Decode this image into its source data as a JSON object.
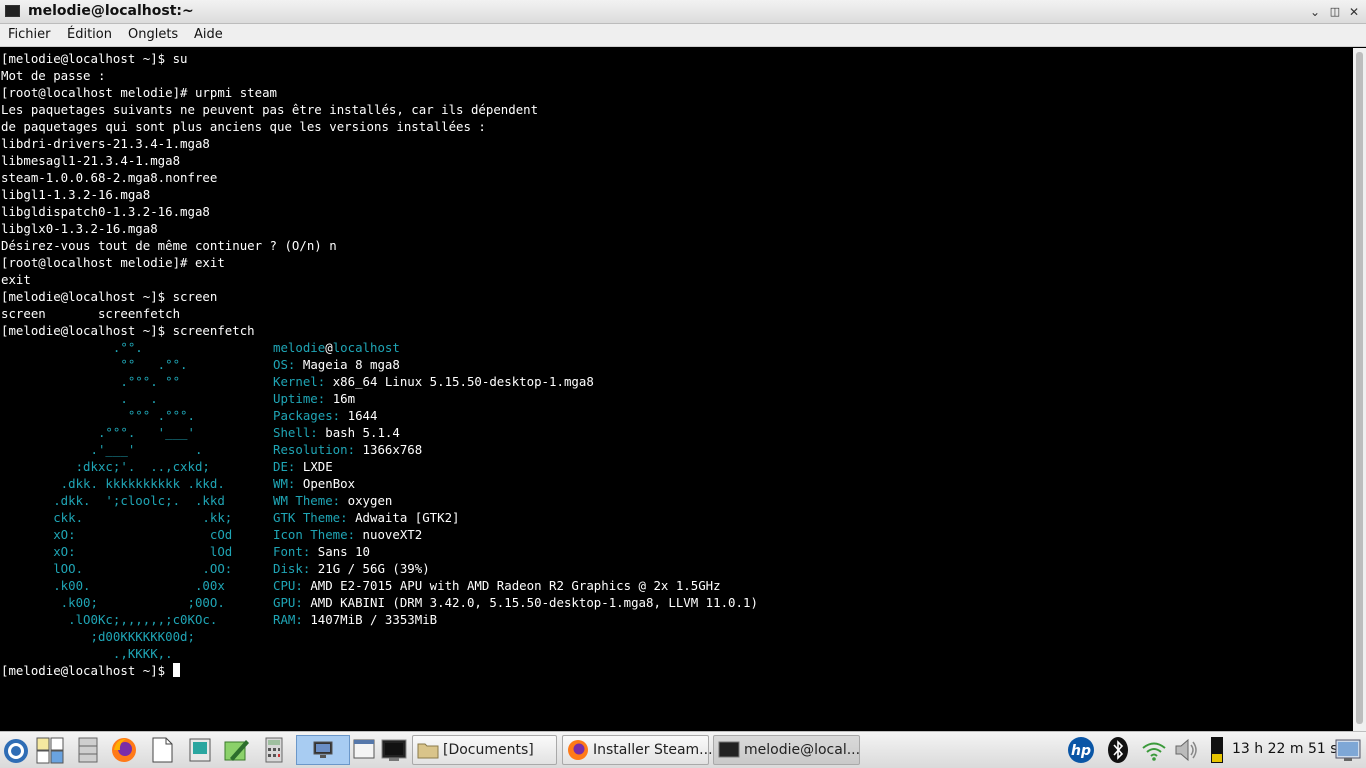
{
  "window": {
    "title": "melodie@localhost:~"
  },
  "menu": [
    "Fichier",
    "Édition",
    "Onglets",
    "Aide"
  ],
  "terminal": {
    "history": [
      "[melodie@localhost ~]$ su",
      "Mot de passe :",
      "[root@localhost melodie]# urpmi steam",
      "Les paquetages suivants ne peuvent pas être installés, car ils dépendent",
      "de paquetages qui sont plus anciens que les versions installées :",
      "libdri-drivers-21.3.4-1.mga8",
      "libmesagl1-21.3.4-1.mga8",
      "steam-1.0.0.68-2.mga8.nonfree",
      "libgl1-1.3.2-16.mga8",
      "libgldispatch0-1.3.2-16.mga8",
      "libglx0-1.3.2-16.mga8",
      "Désirez-vous tout de même continuer ? (O/n) n",
      "[root@localhost melodie]# exit",
      "exit",
      "[melodie@localhost ~]$ screen",
      "screen       screenfetch",
      "[melodie@localhost ~]$ screenfetch"
    ],
    "logo": [
      "               .°°.",
      "                °°   .°°.",
      "                .°°°. °°",
      "                .   .",
      "                 °°° .°°°.",
      "             .°°°.   '___'",
      "            .'___'        .",
      "          :dkxc;'.  ..,cxkd;",
      "        .dkk. kkkkkkkkkk .kkd.",
      "       .dkk.  ';cloolc;.  .kkd",
      "       ckk.                .kk;",
      "       xO:                  cOd",
      "       xO:                  lOd",
      "       lOO.                .OO:",
      "       .k00.              .00x",
      "        .k00;            ;00O.",
      "         .lO0Kc;,,,,,,;c0KOc.",
      "            ;d00KKKKKK00d;",
      "               .,KKKK,."
    ],
    "user": "melodie",
    "host": "localhost",
    "info": [
      {
        "key": "OS:",
        "value": "Mageia 8 mga8"
      },
      {
        "key": "Kernel:",
        "value": "x86_64 Linux 5.15.50-desktop-1.mga8"
      },
      {
        "key": "Uptime:",
        "value": "16m"
      },
      {
        "key": "Packages:",
        "value": "1644"
      },
      {
        "key": "Shell:",
        "value": "bash 5.1.4"
      },
      {
        "key": "Resolution:",
        "value": "1366x768"
      },
      {
        "key": "DE:",
        "value": "LXDE"
      },
      {
        "key": "WM:",
        "value": "OpenBox"
      },
      {
        "key": "WM Theme:",
        "value": "oxygen"
      },
      {
        "key": "GTK Theme:",
        "value": "Adwaita [GTK2]"
      },
      {
        "key": "Icon Theme:",
        "value": "nuoveXT2"
      },
      {
        "key": "Font:",
        "value": "Sans 10"
      },
      {
        "key": "Disk:",
        "value": "21G / 56G (39%)"
      },
      {
        "key": "CPU:",
        "value": "AMD E2-7015 APU with AMD Radeon R2 Graphics @ 2x 1.5GHz"
      },
      {
        "key": "GPU:",
        "value": "AMD KABINI (DRM 3.42.0, 5.15.50-desktop-1.mga8, LLVM 11.0.1)"
      },
      {
        "key": "RAM:",
        "value": "1407MiB / 3353MiB"
      }
    ],
    "prompt": "[melodie@localhost ~]$ "
  },
  "taskbar": {
    "tasks": [
      {
        "label": "[Documents]",
        "icon": "folder-icon"
      },
      {
        "label": "Installer Steam...",
        "icon": "firefox-icon"
      },
      {
        "label": "melodie@local...",
        "icon": "terminal-icon"
      }
    ],
    "clock": "13 h 22 m 51 s"
  },
  "colors": {
    "accent": "#1fa5b5",
    "terminal_bg": "#000000",
    "terminal_fg": "#ffffff"
  }
}
